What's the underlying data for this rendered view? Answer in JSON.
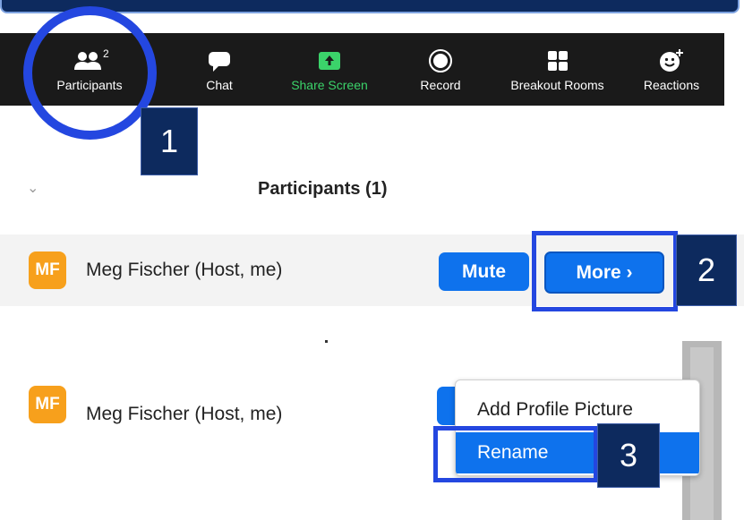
{
  "toolbar": {
    "items": [
      {
        "label": "Participants",
        "icon": "participants-icon",
        "count": "2"
      },
      {
        "label": "Chat",
        "icon": "chat-icon"
      },
      {
        "label": "Share Screen",
        "icon": "share-screen-icon"
      },
      {
        "label": "Record",
        "icon": "record-icon"
      },
      {
        "label": "Breakout Rooms",
        "icon": "breakout-rooms-icon"
      },
      {
        "label": "Reactions",
        "icon": "reactions-icon"
      }
    ]
  },
  "callouts": [
    "1",
    "2",
    "3"
  ],
  "panel": {
    "title": "Participants (1)"
  },
  "participants": [
    {
      "initials": "MF",
      "name": "Meg Fischer (Host, me)",
      "mute_label": "Mute",
      "more_label": "More ›"
    },
    {
      "initials": "MF",
      "name": "Meg Fischer (Host, me)"
    }
  ],
  "context_menu": {
    "items": [
      "Add Profile Picture",
      "Rename"
    ],
    "selected": "Rename"
  },
  "colors": {
    "accent": "#0e72ed",
    "highlight": "#2447e0",
    "callout_bg": "#0d2a5e",
    "avatar": "#f7a01c",
    "share_green": "#3bd36a"
  }
}
